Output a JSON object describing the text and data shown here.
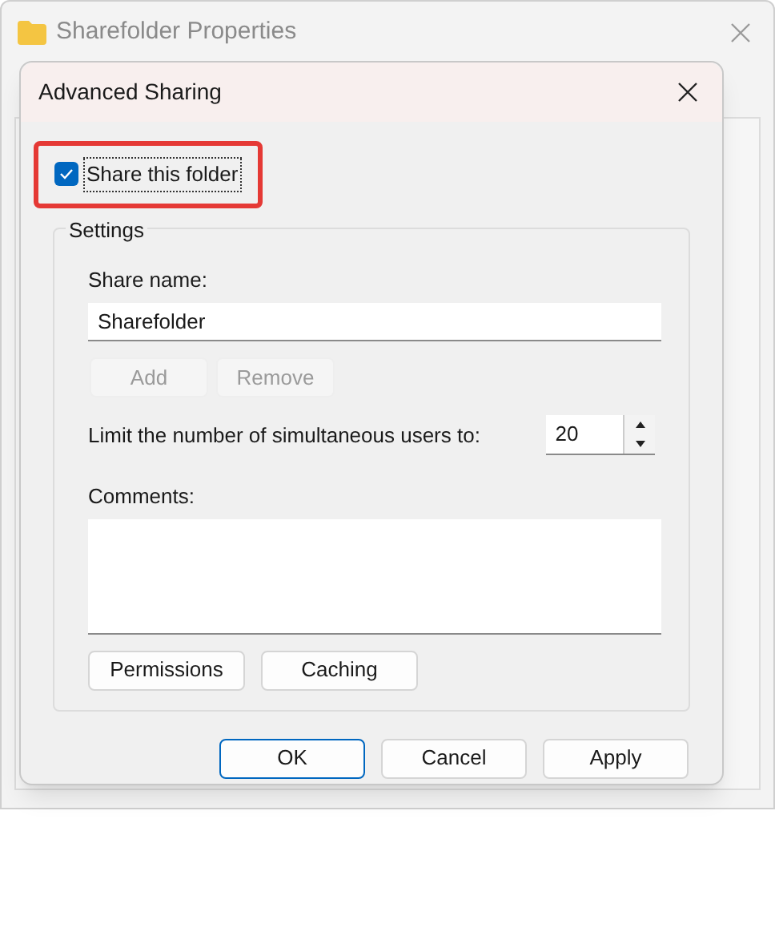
{
  "parent_window": {
    "title": "Sharefolder Properties"
  },
  "dialog": {
    "title": "Advanced Sharing",
    "share_checkbox": {
      "label": "Share this folder",
      "checked": true,
      "highlighted": true
    },
    "settings": {
      "label": "Settings",
      "share_name": {
        "label": "Share name:",
        "value": "Sharefolder"
      },
      "name_buttons": [
        {
          "label": "Add",
          "disabled": true
        },
        {
          "label": "Remove",
          "disabled": true
        }
      ],
      "user_limit": {
        "label": "Limit the number of simultaneous users to:",
        "value": "20"
      },
      "comments": {
        "label": "Comments:"
      },
      "buttons": [
        {
          "label": "Permissions",
          "disabled": false
        },
        {
          "label": "Caching",
          "disabled": false
        }
      ]
    },
    "footer_buttons": [
      {
        "label": "OK",
        "focused": true
      },
      {
        "label": "Cancel",
        "focused": false
      },
      {
        "label": "Apply",
        "focused": false
      }
    ]
  }
}
